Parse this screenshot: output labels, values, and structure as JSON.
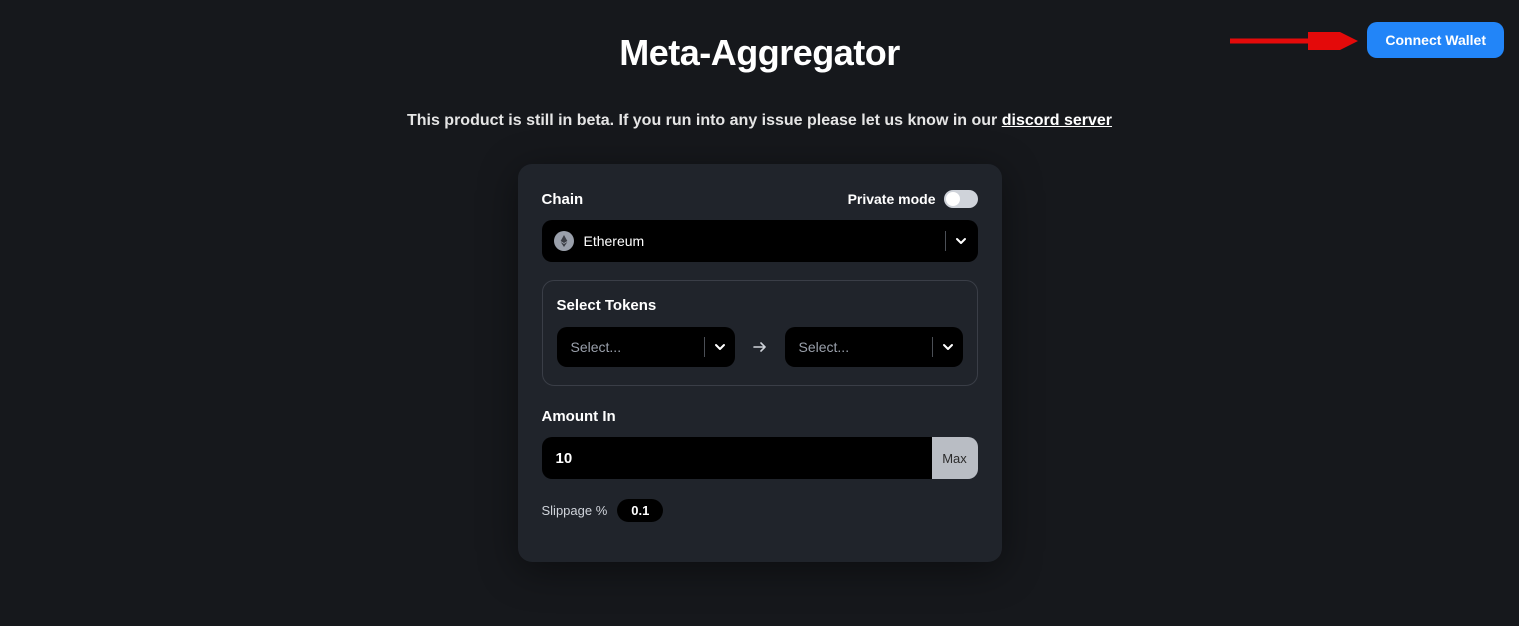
{
  "header": {
    "title": "Meta-Aggregator",
    "connect_wallet_label": "Connect Wallet",
    "beta_notice_prefix": "This product is still in beta. If you run into any issue please let us know in our ",
    "beta_notice_link_text": "discord server"
  },
  "card": {
    "chain_label": "Chain",
    "private_mode_label": "Private mode",
    "chain_selected": "Ethereum",
    "select_tokens_label": "Select Tokens",
    "token_from_placeholder": "Select...",
    "token_to_placeholder": "Select...",
    "amount_in_label": "Amount In",
    "amount_in_value": "10",
    "max_label": "Max",
    "slippage_label": "Slippage %",
    "slippage_value": "0.1"
  }
}
